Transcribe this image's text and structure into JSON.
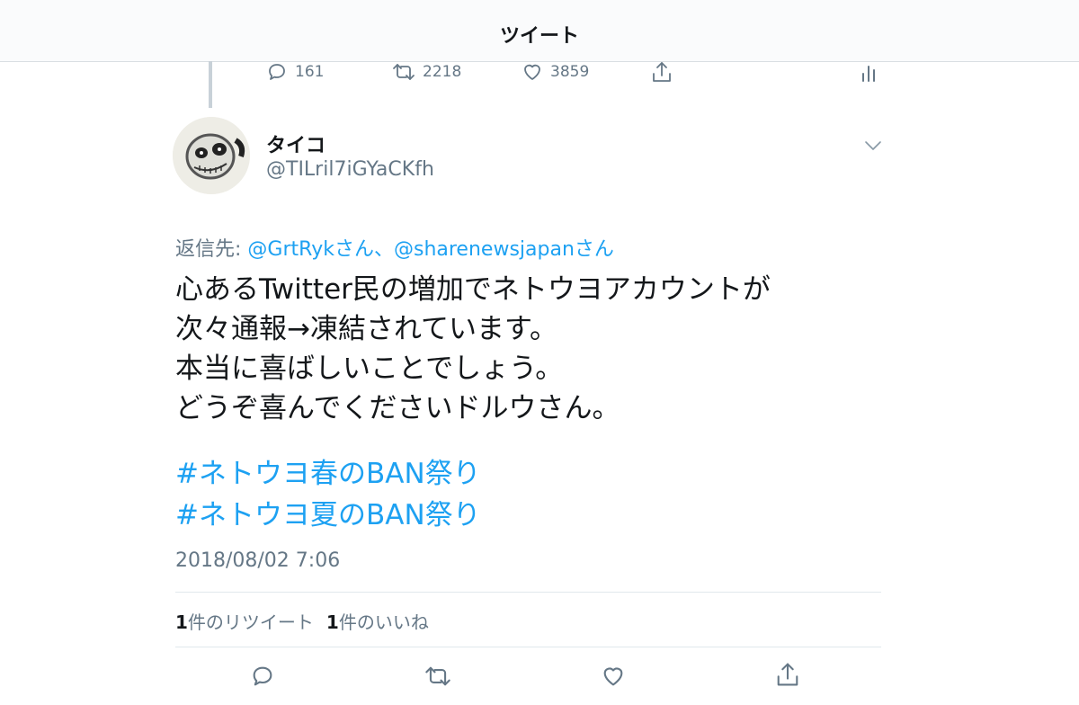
{
  "header": {
    "title": "ツイート"
  },
  "prev_tweet_actions": {
    "reply_count": "161",
    "retweet_count": "2218",
    "like_count": "3859"
  },
  "tweet": {
    "display_name": "タイコ",
    "handle": "@TILril7iGYaCKfh",
    "reply_prefix": "返信先: ",
    "reply_mention_1": "@GrtRykさん",
    "reply_separator": "、",
    "reply_mention_2": "@sharenewsjapanさん",
    "body_lines": [
      "心あるTwitter民の増加でネトウヨアカウントが",
      "次々通報→凍結されています。",
      "本当に喜ばしいことでしょう。",
      "どうぞ喜んでくださいドルウさん。"
    ],
    "hashtags": [
      "#ネトウヨ春のBAN祭り",
      "#ネトウヨ夏のBAN祭り"
    ],
    "timestamp": "2018/08/02 7:06"
  },
  "stats": {
    "retweet_count": "1",
    "retweet_label": "件のリツイート",
    "like_count": "1",
    "like_label": "件のいいね"
  },
  "colors": {
    "link": "#1da1f2",
    "secondary_text": "#657786",
    "icon": "#657786",
    "divider": "#e1e8ed"
  },
  "icons": {
    "reply": "reply-icon",
    "retweet": "retweet-icon",
    "like": "heart-icon",
    "share": "share-icon",
    "analytics": "analytics-icon",
    "caret": "chevron-down-icon"
  }
}
